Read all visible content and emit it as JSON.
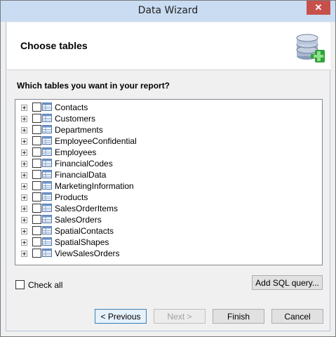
{
  "window": {
    "title": "Data Wizard",
    "close_glyph": "✕"
  },
  "header": {
    "title": "Choose tables",
    "icon": "database-add-icon"
  },
  "question": "Which tables you want in your report?",
  "tables": [
    "Contacts",
    "Customers",
    "Departments",
    "EmployeeConfidential",
    "Employees",
    "FinancialCodes",
    "FinancialData",
    "MarketingInformation",
    "Products",
    "SalesOrderItems",
    "SalesOrders",
    "SpatialContacts",
    "SpatialShapes",
    "ViewSalesOrders"
  ],
  "check_all_label": "Check all",
  "buttons": {
    "add_sql": "Add SQL query...",
    "previous": "< Previous",
    "next": "Next >",
    "finish": "Finish",
    "cancel": "Cancel"
  },
  "colors": {
    "accent": "#3c7fb1",
    "close": "#c7504b",
    "titlebar": "#c9dcf2"
  }
}
